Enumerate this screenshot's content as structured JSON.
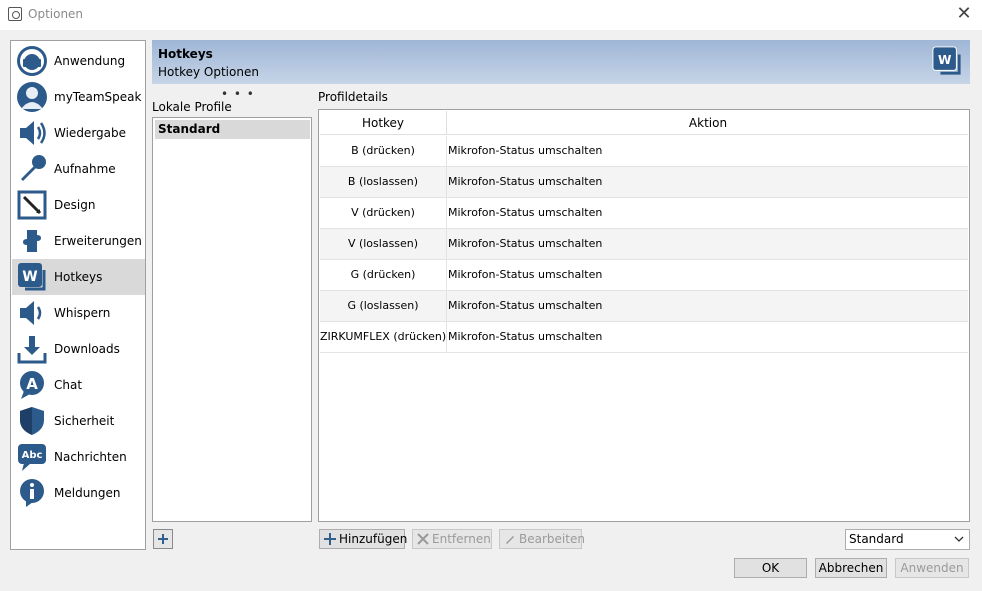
{
  "window": {
    "title": "Optionen",
    "close_glyph": "✕"
  },
  "sidebar": {
    "items": [
      {
        "label": "Anwendung",
        "icon": "headset-icon"
      },
      {
        "label": "myTeamSpeak",
        "icon": "user-icon"
      },
      {
        "label": "Wiedergabe",
        "icon": "speaker-icon"
      },
      {
        "label": "Aufnahme",
        "icon": "microphone-icon"
      },
      {
        "label": "Design",
        "icon": "design-icon"
      },
      {
        "label": "Erweiterungen",
        "icon": "puzzle-icon"
      },
      {
        "label": "Hotkeys",
        "icon": "hotkey-icon",
        "active": true
      },
      {
        "label": "Whispern",
        "icon": "whisper-icon"
      },
      {
        "label": "Downloads",
        "icon": "download-icon"
      },
      {
        "label": "Chat",
        "icon": "chat-icon"
      },
      {
        "label": "Sicherheit",
        "icon": "shield-icon"
      },
      {
        "label": "Nachrichten",
        "icon": "message-icon"
      },
      {
        "label": "Meldungen",
        "icon": "info-icon"
      }
    ]
  },
  "header": {
    "title": "Hotkeys",
    "subtitle": "Hotkey Optionen",
    "icon": "hotkey-icon"
  },
  "profiles": {
    "label": "Lokale Profile",
    "grip": "• • •",
    "items": [
      "Standard"
    ]
  },
  "details": {
    "label": "Profildetails",
    "columns": [
      "Hotkey",
      "Aktion"
    ],
    "rows": [
      {
        "hotkey": "B (drücken)",
        "action": "Mikrofon-Status umschalten"
      },
      {
        "hotkey": "B (loslassen)",
        "action": "Mikrofon-Status umschalten"
      },
      {
        "hotkey": "V (drücken)",
        "action": "Mikrofon-Status umschalten"
      },
      {
        "hotkey": "V (loslassen)",
        "action": "Mikrofon-Status umschalten"
      },
      {
        "hotkey": "G (drücken)",
        "action": "Mikrofon-Status umschalten"
      },
      {
        "hotkey": "G (loslassen)",
        "action": "Mikrofon-Status umschalten"
      },
      {
        "hotkey": "ZIRKUMFLEX (drücken)",
        "action": "Mikrofon-Status umschalten"
      }
    ]
  },
  "buttons": {
    "add": "Hinzufügen",
    "remove": "Entfernen",
    "edit": "Bearbeiten",
    "ok": "OK",
    "cancel": "Abbrechen",
    "apply": "Anwenden"
  },
  "profile_select": {
    "value": "Standard"
  },
  "colors": {
    "accent": "#2c5a8a",
    "header_gradient_top": "#9fb6d6",
    "header_gradient_bottom": "#c6d4e7"
  }
}
